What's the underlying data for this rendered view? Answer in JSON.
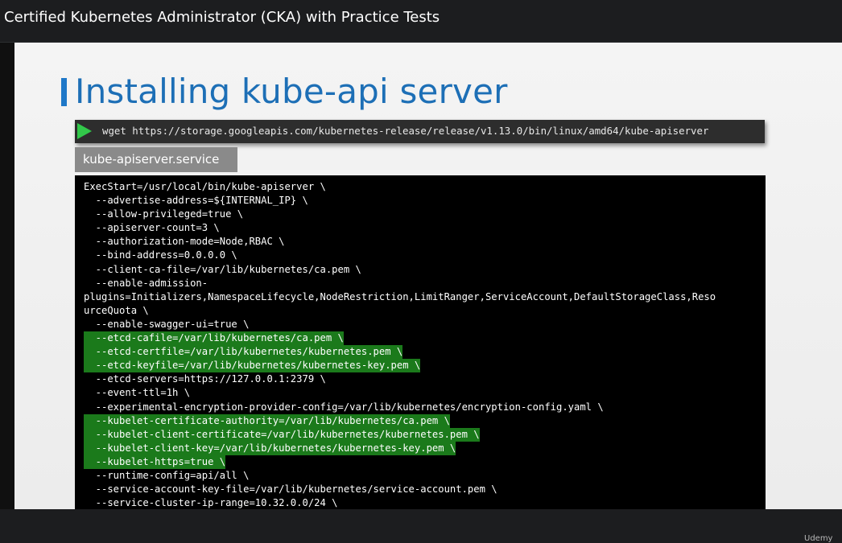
{
  "header": {
    "course_title": "Certified Kubernetes Administrator (CKA) with Practice Tests"
  },
  "slide": {
    "title": "Installing kube-api server",
    "command": "wget https://storage.googleapis.com/kubernetes-release/release/v1.13.0/bin/linux/amd64/kube-apiserver",
    "file_tab": "kube-apiserver.service",
    "code_lines": [
      "ExecStart=/usr/local/bin/kube-apiserver \\",
      "  --advertise-address=${INTERNAL_IP} \\",
      "  --allow-privileged=true \\",
      "  --apiserver-count=3 \\",
      "  --authorization-mode=Node,RBAC \\",
      "  --bind-address=0.0.0.0 \\",
      "  --client-ca-file=/var/lib/kubernetes/ca.pem \\",
      "  --enable-admission-",
      "plugins=Initializers,NamespaceLifecycle,NodeRestriction,LimitRanger,ServiceAccount,DefaultStorageClass,Reso",
      "urceQuota \\",
      "  --enable-swagger-ui=true \\",
      "  --etcd-cafile=/var/lib/kubernetes/ca.pem \\",
      "  --etcd-certfile=/var/lib/kubernetes/kubernetes.pem \\",
      "  --etcd-keyfile=/var/lib/kubernetes/kubernetes-key.pem \\",
      "  --etcd-servers=https://127.0.0.1:2379 \\",
      "  --event-ttl=1h \\",
      "  --experimental-encryption-provider-config=/var/lib/kubernetes/encryption-config.yaml \\",
      "  --kubelet-certificate-authority=/var/lib/kubernetes/ca.pem \\",
      "  --kubelet-client-certificate=/var/lib/kubernetes/kubernetes.pem \\",
      "  --kubelet-client-key=/var/lib/kubernetes/kubernetes-key.pem \\",
      "  --kubelet-https=true \\",
      "  --runtime-config=api/all \\",
      "  --service-account-key-file=/var/lib/kubernetes/service-account.pem \\",
      "  --service-cluster-ip-range=10.32.0.0/24 \\"
    ],
    "highlight_color": "#1b7a1b"
  },
  "watermark": "Udemy"
}
